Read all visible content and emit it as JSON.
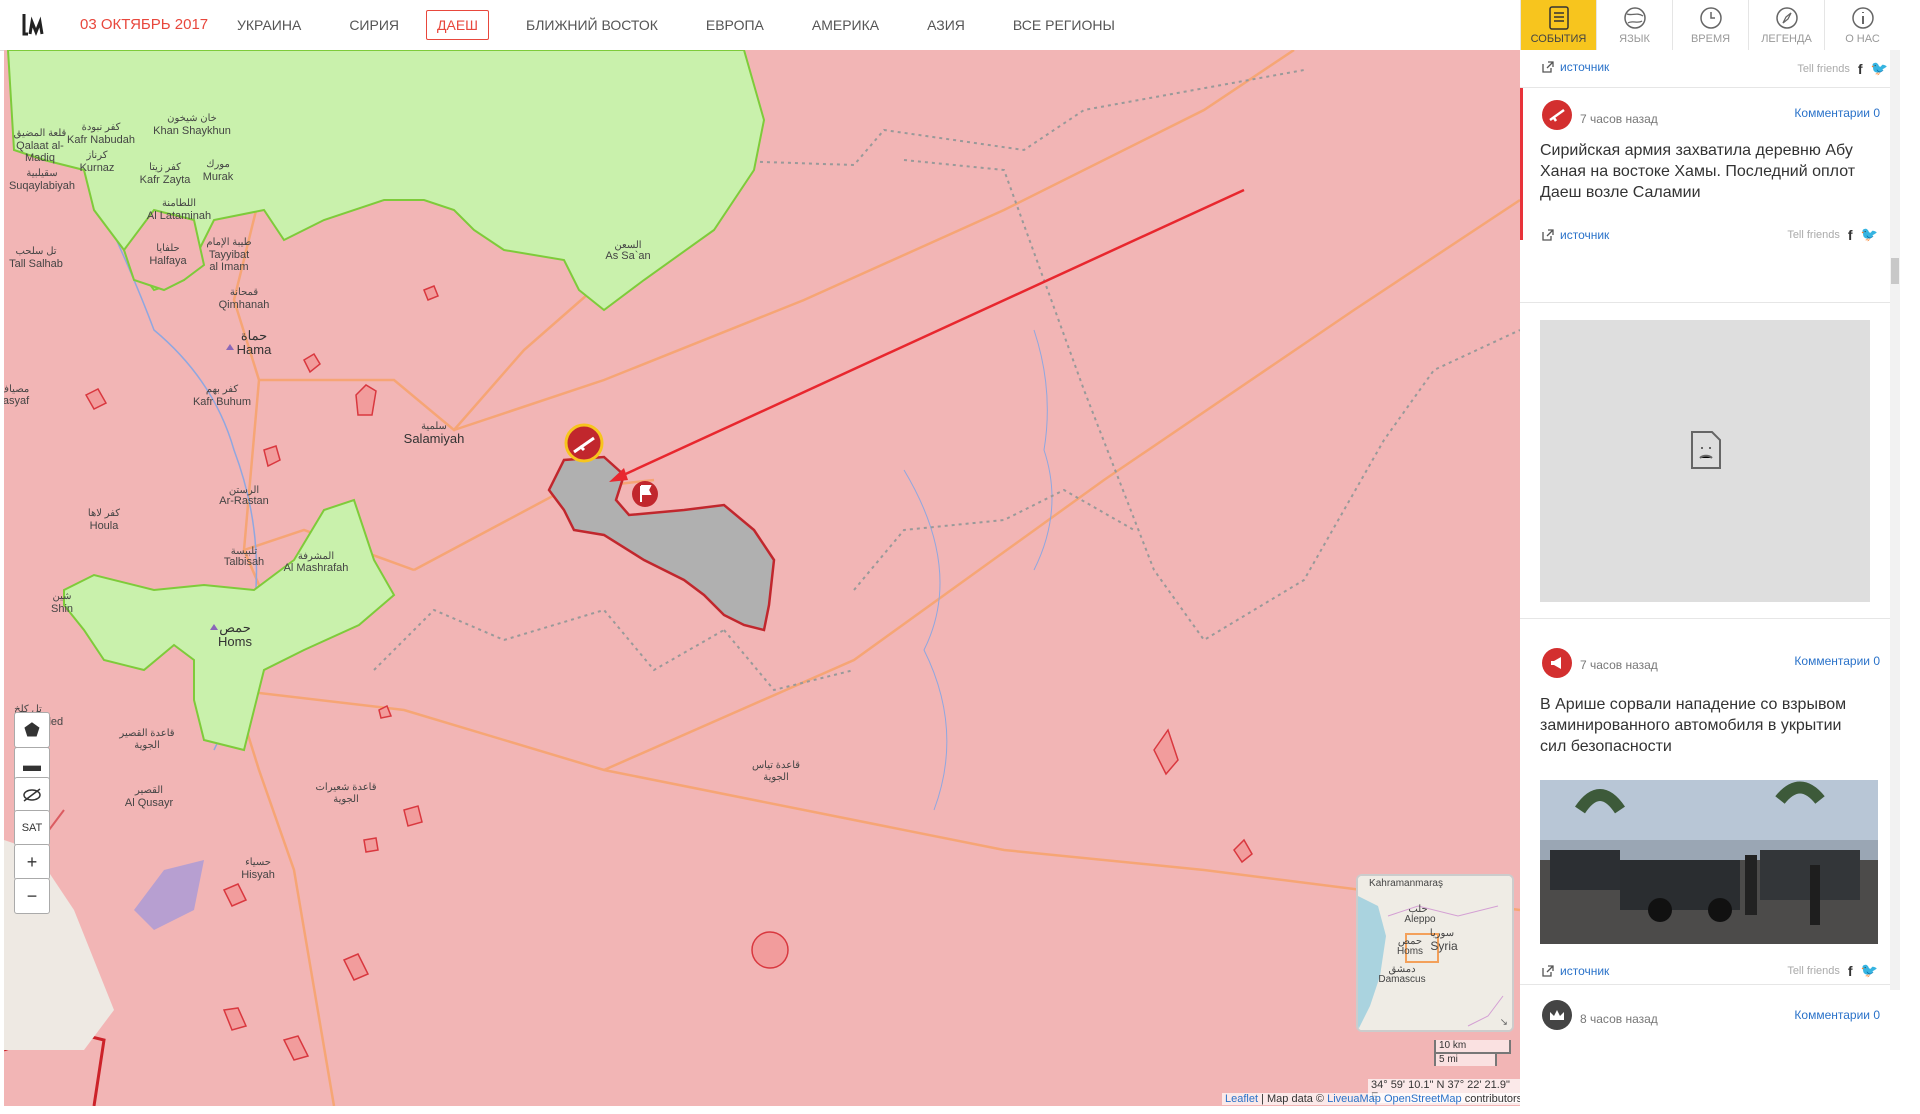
{
  "header": {
    "date": "03 ОКТЯБРЬ 2017",
    "regions": [
      "УКРАИНА",
      "СИРИЯ",
      "ДАЕШ",
      "БЛИЖНИЙ ВОСТОК",
      "ЕВРОПА",
      "АМЕРИКА",
      "АЗИЯ",
      "ВСЕ РЕГИОНЫ"
    ],
    "active_region": "ДАЕШ"
  },
  "tabs": [
    {
      "label": "СОБЫТИЯ",
      "icon": "list-icon"
    },
    {
      "label": "ЯЗЫК",
      "icon": "globe-icon"
    },
    {
      "label": "ВРЕМЯ",
      "icon": "clock-icon"
    },
    {
      "label": "ЛЕГЕНДА",
      "icon": "compass-icon"
    },
    {
      "label": "О НАС",
      "icon": "info-icon"
    }
  ],
  "map": {
    "labels": {
      "kafr_nabudah": "Kafr Nabudah",
      "kafr_nabudah_ar": "كفر نبودة",
      "khan_shaykhun": "Khan Shaykhun",
      "khan_shaykhun_ar": "خان شيخون",
      "qalaat_ar": "قلعة المضيق",
      "qalaat": "Qalaat al-\nMadiq",
      "kurnaz_ar": "كرناز",
      "kurnaz": "Kurnaz",
      "kafr_zayta_ar": "كفر زيتا",
      "kafr_zayta": "Kafr Zayta",
      "murak_ar": "مورك",
      "murak": "Murak",
      "suqaylabiyah_ar": "سقيلبية",
      "suqaylabiyah": "Suqaylabiyah",
      "latamina_ar": "اللطامنة",
      "latamina": "Al Lataminah",
      "tall_salhab_ar": "تل سلحب",
      "tall_salhab": "Tall Salhab",
      "halfaya_ar": "حلفايا",
      "halfaya": "Halfaya",
      "tayyibat_ar": "طيبة الإمام",
      "tayyibat": "Tayyibat\nal Imam",
      "as_saan_ar": "السعن",
      "as_saan": "As Sa`an",
      "qimhanah_ar": "قمحانة",
      "qimhanah": "Qimhanah",
      "hama_ar": "حماة",
      "hama": "Hama",
      "kafr_buhum_ar": "كفر بهم",
      "kafr_buhum": "Kafr Buhum",
      "masyaf": "asyaf",
      "masyaf_ar": "مصياف",
      "salamiyah_ar": "سلمية",
      "salamiyah": "Salamiyah",
      "rastan_ar": "الرستن",
      "rastan": "Ar-Rastan",
      "kafr_laha_ar": "كفر لاها",
      "houla": "Houla",
      "talbisah_ar": "تلبيسة",
      "talbisah": "Talbisah",
      "mashrafah_ar": "المشرفة",
      "mashrafah": "Al Mashrafah",
      "shin_ar": "شين",
      "shin": "Shin",
      "homs_ar": "حمص",
      "homs": "Homs",
      "khaled": "Khaled",
      "khaled_ar": "تل كلخ",
      "qusayr_base_ar": "قاعدة القصير\nالجوية",
      "qusayr_ar": "القصير",
      "qusayr": "Al Qusayr",
      "shayrat_ar": "قاعدة شعيرات\nالجوية",
      "tiyas_ar": "قاعدة تياس\nالجوية",
      "hisyah_ar": "حسياء",
      "hisyah": "Hisyah"
    },
    "controls": [
      "+",
      "−",
      "SAT"
    ],
    "minimap": {
      "labels": [
        "Kahramanmaraş",
        "حلب",
        "Aleppo",
        "سوريا",
        "Syria",
        "حمص",
        "Homs",
        "دمشق",
        "Damascus"
      ]
    },
    "scale": {
      "km": "10 km",
      "mi": "5 mi"
    },
    "coordinates": "34° 59' 10.1\" N 37° 22' 21.9\" E",
    "attribution": {
      "leaflet": "Leaflet",
      "mid": " | Map data © ",
      "liveua": "LiveuaMap",
      "osm": "OpenStreetMap",
      "tail": " contributors"
    }
  },
  "sidebar": {
    "top_source": "источник",
    "top_tell": "Tell friends",
    "events": [
      {
        "time": "7 часов назад",
        "comments": "Комментарии 0",
        "text": "Сирийская армия захватила деревню Абу Ханая на востоке Хамы. Последний оплот Даеш возле Саламии",
        "source": "источник",
        "tell": "Tell friends",
        "icon": "rifle-icon",
        "color": "#d32f2f"
      },
      {
        "time": "7 часов назад",
        "comments": "Комментарии 0",
        "text": "В Арише сорвали нападение со взрывом заминированного автомобиля в укрытии сил безопасности",
        "source": "источник",
        "tell": "Tell friends",
        "icon": "megaphone-icon",
        "color": "#d32f2f"
      },
      {
        "time": "8 часов назад",
        "comments": "Комментарии 0",
        "icon": "crown-icon",
        "color": "#444444"
      }
    ]
  },
  "colors": {
    "accent": "#e8473c",
    "tab_active": "#f7c51e",
    "government_area": "#f2b5b5",
    "rebel_area": "#c8f0a8",
    "isis_area": "#b0b0b0",
    "link": "#2a72c9"
  }
}
